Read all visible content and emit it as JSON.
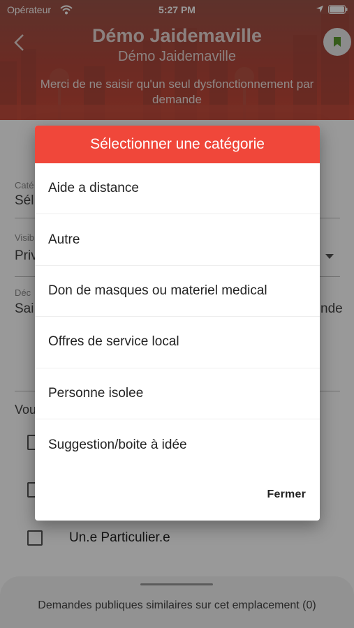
{
  "status_bar": {
    "carrier": "Opérateur",
    "time": "5:27 PM"
  },
  "header": {
    "title": "Démo Jaidemaville",
    "subtitle": "Démo Jaidemaville",
    "note": "Merci de ne saisir qu'un seul dysfonctionnement par demande"
  },
  "form": {
    "category_label": "Caté",
    "category_value": "Sél",
    "visibility_label": "Visib",
    "visibility_value": "Priv",
    "description_label": "Déc",
    "description_value": "Sai",
    "description_overflow": "nde",
    "you_label": "Vou",
    "options": [
      "Un.e Particulier.e"
    ]
  },
  "bottom_sheet": {
    "text": "Demandes publiques similaires sur cet emplacement (0)"
  },
  "dialog": {
    "title": "Sélectionner une catégorie",
    "options": [
      "Aide a distance",
      "Autre",
      "Don de masques ou materiel medical",
      "Offres de service local",
      "Personne isolee",
      "Suggestion/boite à idée"
    ],
    "close_label": "Fermer"
  },
  "colors": {
    "accent": "#f0473a",
    "header_bg": "#b4483b",
    "bookmark": "#5a9a2e"
  },
  "icons": [
    "wifi-icon",
    "location-icon",
    "battery-icon",
    "back-icon",
    "bookmark-icon",
    "chevron-down-icon"
  ]
}
